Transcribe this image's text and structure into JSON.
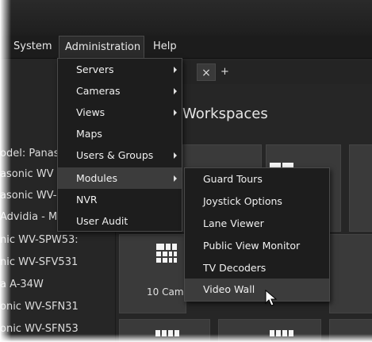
{
  "menubar": {
    "items": [
      "System",
      "Administration",
      "Help"
    ],
    "active": "Administration"
  },
  "tabs": {
    "close_glyph": "×",
    "add_glyph": "+"
  },
  "workspace": {
    "title": "Workspaces",
    "tile_label": "10 Cam"
  },
  "left_list": {
    "items": [
      "odel: Panas",
      "asonic WV",
      "asonic WV-",
      "Advidia - M",
      "nic WV-SPW53:",
      "nic WV-SFV531",
      "a A-34W",
      "onic WV-SFN31",
      "onic WV-SFN53"
    ]
  },
  "administration_menu": {
    "items": [
      {
        "label": "Servers",
        "submenu": true
      },
      {
        "label": "Cameras",
        "submenu": true
      },
      {
        "label": "Views",
        "submenu": true
      },
      {
        "label": "Maps",
        "submenu": false
      },
      {
        "label": "Users & Groups",
        "submenu": true
      },
      {
        "label": "Modules",
        "submenu": true
      },
      {
        "label": "NVR",
        "submenu": false
      },
      {
        "label": "User Audit",
        "submenu": false
      }
    ],
    "highlighted": "Modules"
  },
  "modules_submenu": {
    "items": [
      "Guard Tours",
      "Joystick Options",
      "Lane Viewer",
      "Public View Monitor",
      "TV Decoders",
      "Video Wall"
    ],
    "highlighted": "Video Wall"
  },
  "icons": {
    "cursor": "mouse-pointer-icon",
    "grid": "grid-layout-icon",
    "submenu_arrow": "chevron-right-icon"
  }
}
